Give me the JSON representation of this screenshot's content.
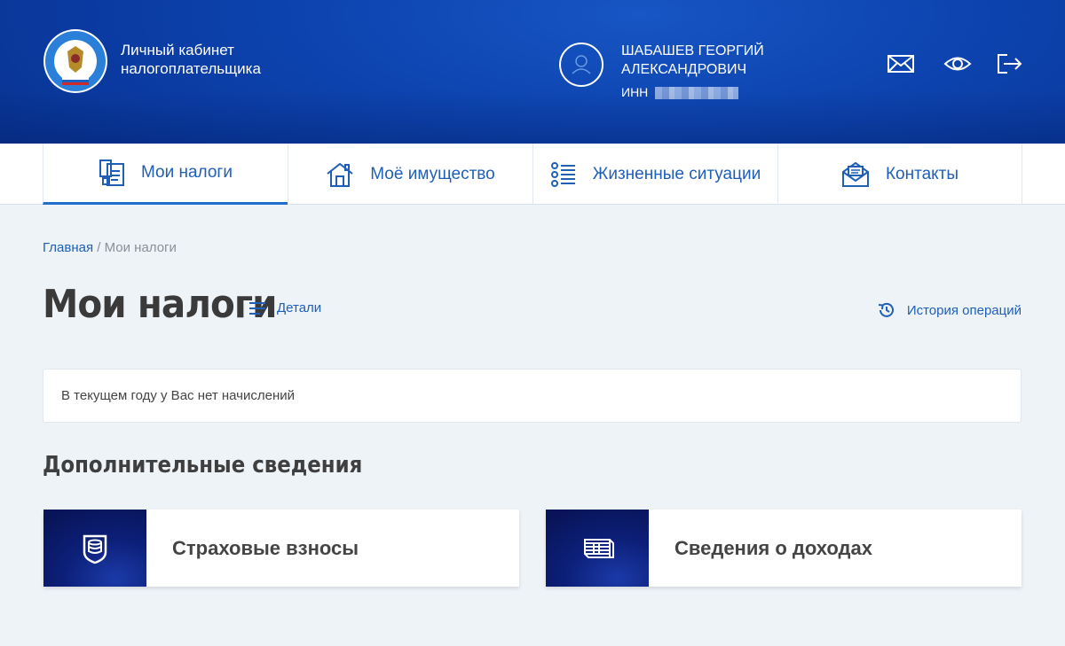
{
  "header": {
    "app_title_line1": "Личный кабинет",
    "app_title_line2": "налогоплательщика",
    "user_name_line1": "ШАБАШЕВ ГЕОРГИЙ",
    "user_name_line2": "АЛЕКСАНДРОВИЧ",
    "inn_label": "ИНН",
    "icons": [
      "mail-icon",
      "eye-icon",
      "logout-icon"
    ]
  },
  "nav": {
    "items": [
      {
        "label": "Мои налоги",
        "icon": "tax-documents-icon",
        "active": true
      },
      {
        "label": "Моё имущество",
        "icon": "house-icon",
        "active": false
      },
      {
        "label": "Жизненные ситуации",
        "icon": "list-icon",
        "active": false
      },
      {
        "label": "Контакты",
        "icon": "envelope-open-icon",
        "active": false
      }
    ]
  },
  "breadcrumb": {
    "home": "Главная",
    "separator": "/",
    "current": "Мои налоги"
  },
  "main": {
    "title": "Мои налоги",
    "details_label": "Детали",
    "history_label": "История операций",
    "notice": "В текущем году у Вас нет начислений",
    "section_title": "Дополнительные сведения",
    "cards": [
      {
        "label": "Страховые взносы",
        "icon": "coins-shield-icon"
      },
      {
        "label": "Сведения о доходах",
        "icon": "money-stack-icon"
      }
    ]
  },
  "colors": {
    "header_blue": "#0d44b0",
    "accent": "#1f5fb8",
    "background": "#eef3f8"
  }
}
